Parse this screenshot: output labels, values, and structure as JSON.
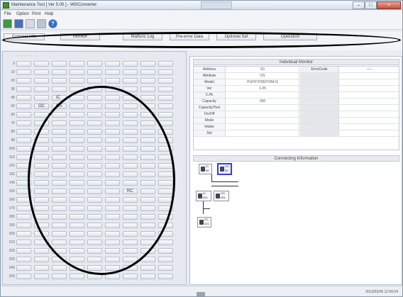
{
  "window": {
    "title": "Maintenance Tool [ Ver 5.00 ] - WiSConverter"
  },
  "menu": [
    "File",
    "Option",
    "Print",
    "Help"
  ],
  "tabs": [
    "Connect Info",
    "Monitor",
    "Malfunc Log",
    "Pre-error Data",
    "Optional Set",
    "Operation"
  ],
  "grid": {
    "rows": [
      "0",
      "10",
      "20",
      "30",
      "40",
      "50",
      "60",
      "70",
      "80",
      "90",
      "100",
      "110",
      "120",
      "130",
      "140",
      "150",
      "160",
      "170",
      "180",
      "190",
      "200",
      "210",
      "220",
      "230",
      "240",
      "250"
    ],
    "marks": [
      {
        "row": 4,
        "col": 2,
        "text": "IC"
      },
      {
        "row": 5,
        "col": 1,
        "text": "OC"
      },
      {
        "row": 5,
        "col": 2,
        "text": "OS"
      },
      {
        "row": 15,
        "col": 6,
        "text": "RC"
      }
    ]
  },
  "individual_monitor": {
    "header": "Individual Monitor",
    "rows": [
      {
        "label": "Address",
        "value": "50",
        "err_label": "ErrorCode",
        "err_value": "-----"
      },
      {
        "label": "Attribute",
        "value": "OS",
        "err_label": "",
        "err_value": ""
      },
      {
        "label": "Model",
        "value": "PUHY-P250YDM-G",
        "err_label": "",
        "err_value": ""
      },
      {
        "label": "Ver",
        "value": "1.05",
        "err_label": "",
        "err_value": ""
      },
      {
        "label": "CJ%",
        "value": "",
        "err_label": "",
        "err_value": ""
      },
      {
        "label": "Capacity",
        "value": "250",
        "err_label": "",
        "err_value": ""
      },
      {
        "label": "Capacity/Tool",
        "value": "",
        "err_label": "",
        "err_value": ""
      },
      {
        "label": "On/Off",
        "value": "",
        "err_label": "",
        "err_value": ""
      },
      {
        "label": "Mode",
        "value": "",
        "err_label": "",
        "err_value": ""
      },
      {
        "label": "Intake",
        "value": "",
        "err_label": "",
        "err_value": ""
      },
      {
        "label": "Set",
        "value": "",
        "err_label": "",
        "err_value": ""
      }
    ]
  },
  "connecting_information": {
    "header": "Connecting Information",
    "nodes": [
      {
        "label": "IC",
        "sub": "50"
      },
      {
        "label": "OS",
        "sub": "50"
      },
      {
        "label": "IC",
        "sub": "001"
      },
      {
        "label": "OS",
        "sub": "051"
      },
      {
        "label": "RC",
        "sub": "101"
      }
    ]
  },
  "status": {
    "time": "2013/03/06 12:56:04"
  },
  "colors": {
    "annotation": "#000000",
    "selected_node": "#3a3fd0",
    "close_button": "#c6523f"
  }
}
